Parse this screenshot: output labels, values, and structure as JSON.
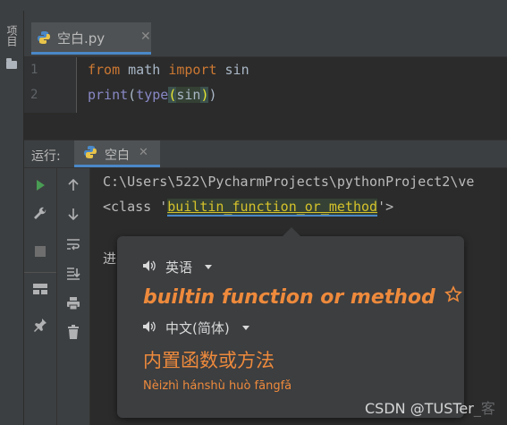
{
  "project_tool_label": "项目",
  "editor": {
    "tab_label": "空白.py",
    "lines": [
      {
        "num": "1",
        "tokens": [
          "from",
          "math",
          "import",
          "sin"
        ]
      },
      {
        "num": "2",
        "tokens": [
          "print",
          "(",
          "type",
          "(",
          "sin",
          ")",
          ")"
        ]
      }
    ]
  },
  "run": {
    "label": "运行:",
    "tab_label": "空白",
    "console_path": "C:\\Users\\522\\PycharmProjects\\pythonProject2\\ve",
    "class_prefix": "<class '",
    "class_name": "builtin_function_or_method",
    "class_suffix": "'>",
    "partial_line": "进"
  },
  "translation": {
    "source_lang": "英语",
    "term": "builtin function or method",
    "target_lang": "中文(简体)",
    "translation": "内置函数或方法",
    "pinyin": "Nèizhì hánshù huò fāngfǎ"
  },
  "watermark": "CSDN @TUSTer",
  "watermark_tail": "_客"
}
